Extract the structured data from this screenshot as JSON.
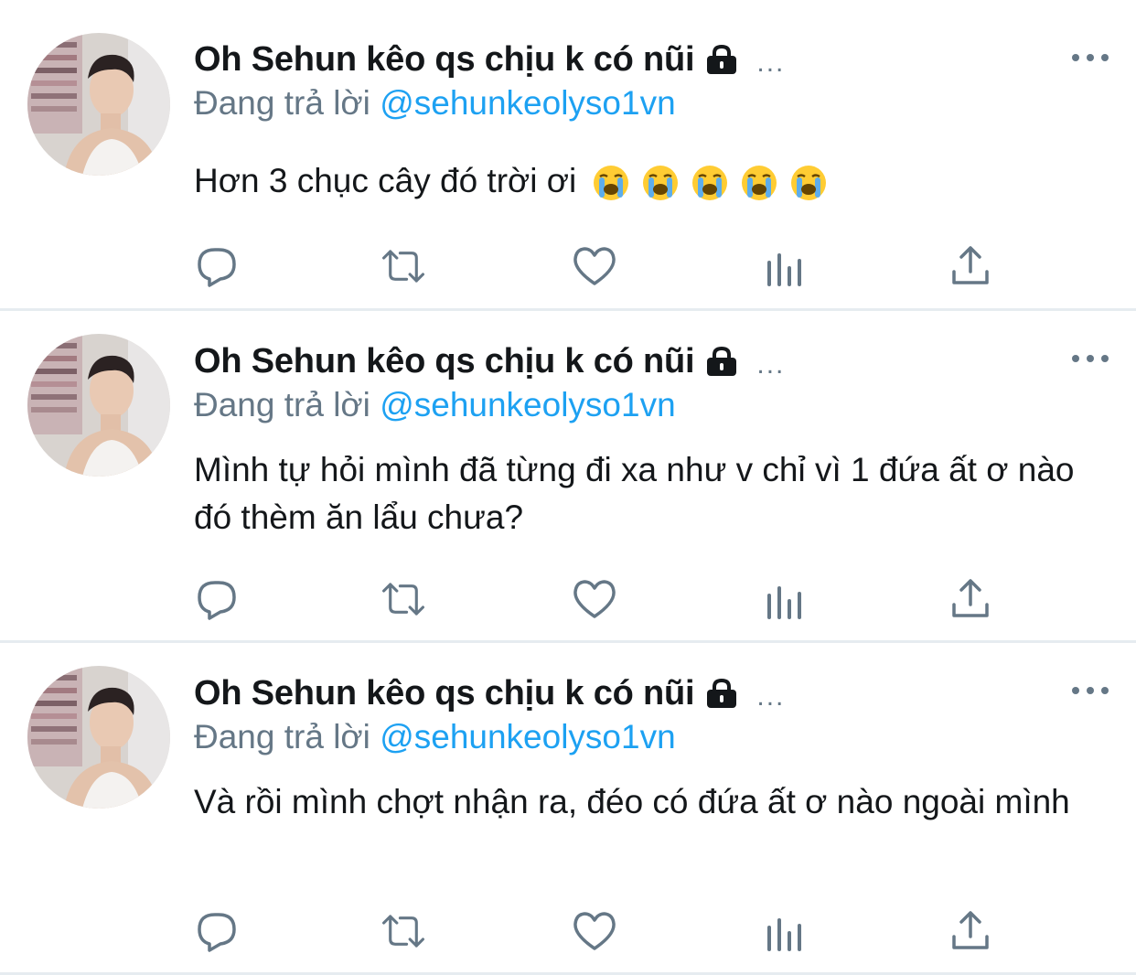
{
  "colors": {
    "name": "#14171a",
    "secondary": "#657786",
    "link": "#1da1f2",
    "divider": "#e6ecf0",
    "icon": "#657786"
  },
  "tweets": [
    {
      "display_name": "Oh Sehun kêo qs chịu k có nũi",
      "name_suffix": "...",
      "reply_prefix": "Đang trả lời",
      "reply_handle": "@sehunkeolyso1vn",
      "text": "Hơn 3 chục cây đó trời ơi",
      "emojis": [
        "loudly-crying-face",
        "loudly-crying-face",
        "loudly-crying-face",
        "loudly-crying-face",
        "loudly-crying-face"
      ]
    },
    {
      "display_name": "Oh Sehun kêo qs chịu k có nũi",
      "name_suffix": "...",
      "reply_prefix": "Đang trả lời",
      "reply_handle": "@sehunkeolyso1vn",
      "text": "Mình tự hỏi mình đã từng đi xa như v chỉ vì 1 đứa ất ơ nào đó thèm ăn lẩu chưa?",
      "emojis": []
    },
    {
      "display_name": "Oh Sehun kêo qs chịu k có nũi",
      "name_suffix": "...",
      "reply_prefix": "Đang trả lời",
      "reply_handle": "@sehunkeolyso1vn",
      "text": "Và rồi mình chợt nhận ra, đéo có đứa ất ơ nào ngoài mình",
      "emojis": []
    }
  ],
  "icons": {
    "lock": "lock-icon",
    "more": "more-options-icon",
    "reply": "reply-icon",
    "retweet": "retweet-icon",
    "like": "heart-icon",
    "views": "analytics-icon",
    "share": "share-icon"
  }
}
